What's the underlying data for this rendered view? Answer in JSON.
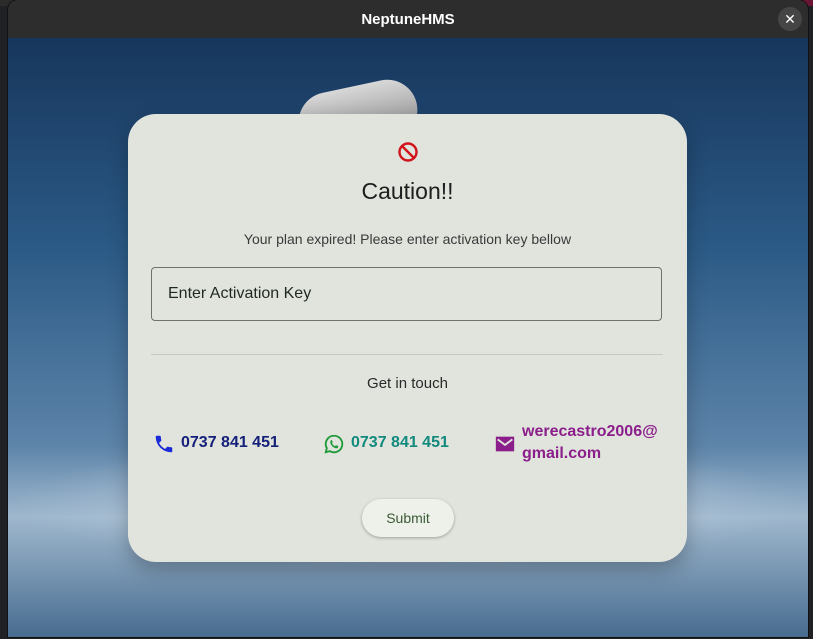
{
  "window": {
    "title": "NeptuneHMS",
    "close_label": "✕"
  },
  "dialog": {
    "title": "Caution!!",
    "message": "Your plan expired! Please enter activation key bellow",
    "activation_placeholder": "Enter Activation Key",
    "get_in_touch": "Get in touch",
    "submit_label": "Submit"
  },
  "contacts": {
    "phone": {
      "icon": "phone-icon",
      "text": "0737 841 451",
      "color": "#14207a"
    },
    "whatsapp": {
      "icon": "whatsapp-icon",
      "text": "0737 841 451",
      "color": "#118a7e"
    },
    "email": {
      "icon": "mail-icon",
      "text": "werecastro2006@gmail.com",
      "color": "#8b1e8b"
    }
  },
  "colors": {
    "card_background": "#e1e4dd",
    "caution_icon": "#d1141b",
    "titlebar": "#2d2d2d"
  }
}
